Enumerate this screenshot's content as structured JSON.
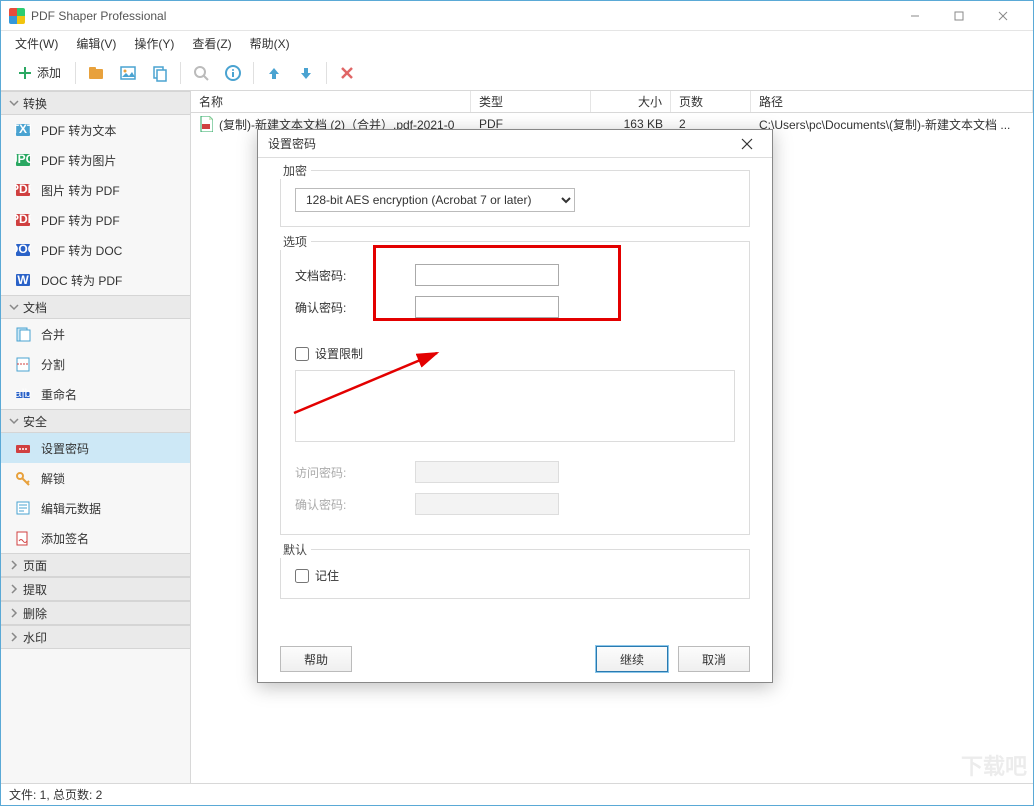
{
  "window": {
    "title": "PDF Shaper Professional"
  },
  "menu": {
    "file": "文件(W)",
    "edit": "编辑(V)",
    "action": "操作(Y)",
    "view": "查看(Z)",
    "help": "帮助(X)"
  },
  "toolbar": {
    "add": "添加"
  },
  "sidebar": {
    "groups": {
      "convert": "转换",
      "document": "文档",
      "security": "安全",
      "pages": "页面",
      "extract": "提取",
      "delete": "删除",
      "watermark": "水印"
    },
    "items": {
      "pdf_to_text": "PDF 转为文本",
      "pdf_to_image": "PDF 转为图片",
      "image_to_pdf": "图片 转为 PDF",
      "pdf_to_pdf": "PDF 转为 PDF",
      "pdf_to_doc": "PDF 转为 DOC",
      "doc_to_pdf": "DOC 转为 PDF",
      "merge": "合并",
      "split": "分割",
      "rename": "重命名",
      "set_password": "设置密码",
      "unlock": "解锁",
      "edit_metadata": "编辑元数据",
      "add_signature": "添加签名"
    }
  },
  "columns": {
    "name": "名称",
    "type": "类型",
    "size": "大小",
    "pages": "页数",
    "path": "路径"
  },
  "files": [
    {
      "name": "(复制)-新建文本文档 (2)（合并）.pdf-2021-0",
      "type": "PDF",
      "size": "163 KB",
      "pages": "2",
      "path": "C:\\Users\\pc\\Documents\\(复制)-新建文本文档 ..."
    }
  ],
  "statusbar": {
    "text": "文件: 1, 总页数: 2"
  },
  "dialog": {
    "title": "设置密码",
    "enc_group": "加密",
    "enc_option": "128-bit AES encryption (Acrobat 7 or later)",
    "opt_group": "选项",
    "doc_pwd": "文档密码:",
    "confirm_pwd": "确认密码:",
    "set_restrict": "设置限制",
    "access_pwd": "访问密码:",
    "confirm_pwd2": "确认密码:",
    "default_group": "默认",
    "remember": "记住",
    "help": "帮助",
    "continue": "继续",
    "cancel": "取消"
  },
  "watermark": "下载吧"
}
